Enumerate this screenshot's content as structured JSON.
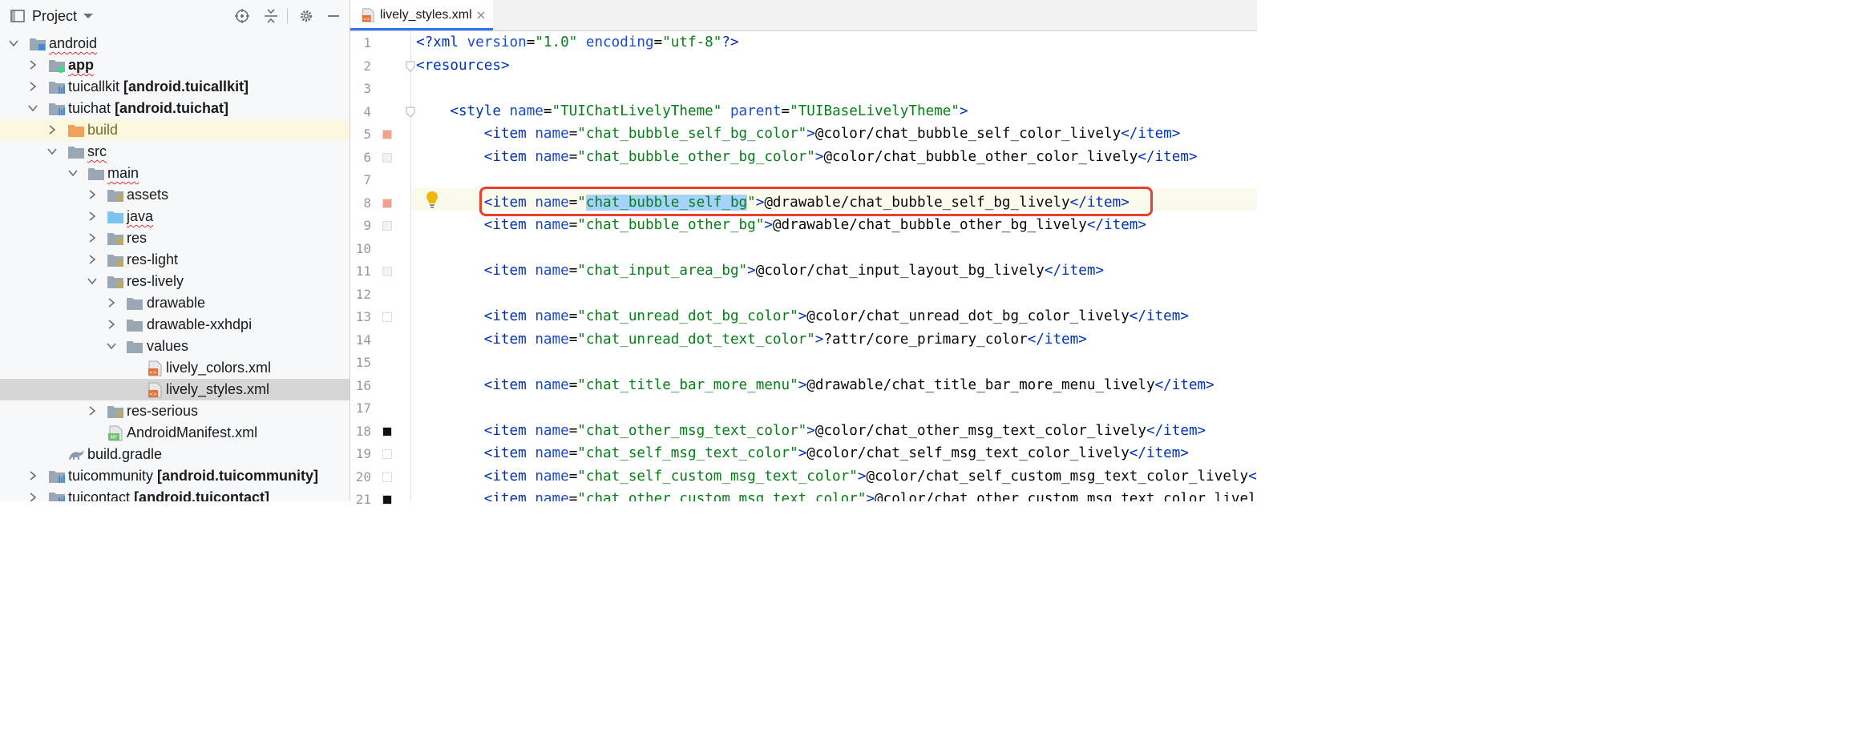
{
  "project_panel": {
    "title": "Project",
    "tree": [
      {
        "label": "android",
        "module": ""
      },
      {
        "label": "app",
        "module": ""
      },
      {
        "label": "tuicallkit",
        "module": "[android.tuicallkit]"
      },
      {
        "label": "tuichat",
        "module": "[android.tuichat]"
      },
      {
        "label": "build",
        "module": ""
      },
      {
        "label": "src",
        "module": ""
      },
      {
        "label": "main",
        "module": ""
      },
      {
        "label": "assets",
        "module": ""
      },
      {
        "label": "java",
        "module": ""
      },
      {
        "label": "res",
        "module": ""
      },
      {
        "label": "res-light",
        "module": ""
      },
      {
        "label": "res-lively",
        "module": ""
      },
      {
        "label": "drawable",
        "module": ""
      },
      {
        "label": "drawable-xxhdpi",
        "module": ""
      },
      {
        "label": "values",
        "module": ""
      },
      {
        "label": "lively_colors.xml",
        "module": ""
      },
      {
        "label": "lively_styles.xml",
        "module": ""
      },
      {
        "label": "res-serious",
        "module": ""
      },
      {
        "label": "AndroidManifest.xml",
        "module": ""
      },
      {
        "label": "build.gradle",
        "module": ""
      },
      {
        "label": "tuicommunity",
        "module": "[android.tuicommunity]"
      },
      {
        "label": "tuicontact",
        "module": "[android.tuicontact]"
      }
    ]
  },
  "editor": {
    "tab_label": "lively_styles.xml",
    "line_numbers": [
      "1",
      "2",
      "3",
      "4",
      "5",
      "6",
      "7",
      "8",
      "9",
      "10",
      "11",
      "12",
      "13",
      "14",
      "15",
      "16",
      "17",
      "18",
      "19",
      "20",
      "21"
    ],
    "lines": [
      "<?xml version=\"1.0\" encoding=\"utf-8\"?>",
      "<resources>",
      "",
      "    <style name=\"TUIChatLivelyTheme\" parent=\"TUIBaseLivelyTheme\">",
      "        <item name=\"chat_bubble_self_bg_color\">@color/chat_bubble_self_color_lively</item>",
      "        <item name=\"chat_bubble_other_bg_color\">@color/chat_bubble_other_color_lively</item>",
      "",
      "        <item name=\"chat_bubble_self_bg\">@drawable/chat_bubble_self_bg_lively</item>",
      "        <item name=\"chat_bubble_other_bg\">@drawable/chat_bubble_other_bg_lively</item>",
      "",
      "        <item name=\"chat_input_area_bg\">@color/chat_input_layout_bg_lively</item>",
      "",
      "        <item name=\"chat_unread_dot_bg_color\">@color/chat_unread_dot_bg_color_lively</item>",
      "        <item name=\"chat_unread_dot_text_color\">?attr/core_primary_color</item>",
      "",
      "        <item name=\"chat_title_bar_more_menu\">@drawable/chat_title_bar_more_menu_lively</item>",
      "",
      "        <item name=\"chat_other_msg_text_color\">@color/chat_other_msg_text_color_lively</item>",
      "        <item name=\"chat_self_msg_text_color\">@color/chat_self_msg_text_color_lively</item>",
      "        <item name=\"chat_self_custom_msg_text_color\">@color/chat_self_custom_msg_text_color_lively</item>",
      "        <item name=\"chat_other_custom_msg_text_color\">@color/chat_other_custom_msg_text_color_lively</item>"
    ],
    "selected_text": "chat_bubble_self_bg",
    "gutter_colors": {
      "5": "#f4a08a",
      "6": "#f2f2f2",
      "8": "#f4a08a",
      "9": "#f2f2f2",
      "11": "#f4f4f4",
      "13": "#ffffff",
      "18": "#111111",
      "19": "#ffffff",
      "20": "#ffffff",
      "21": "#111111"
    },
    "accent": "#3574f0",
    "highlight_border": "#e5412d"
  }
}
